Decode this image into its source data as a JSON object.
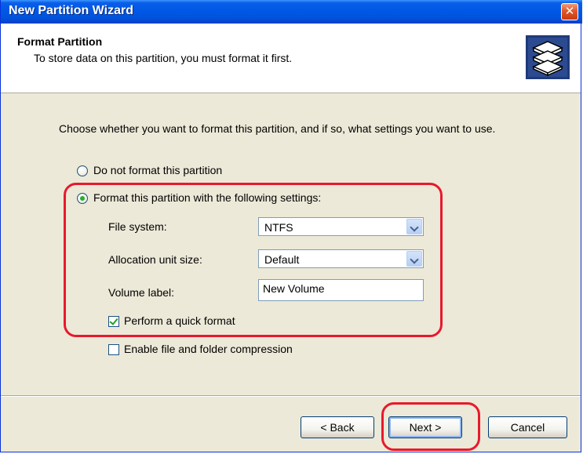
{
  "window": {
    "title": "New Partition Wizard",
    "close_symbol": "✕"
  },
  "header": {
    "title": "Format Partition",
    "subtitle": "To store data on this partition, you must format it first.",
    "icon": "disk-stack-icon"
  },
  "content": {
    "intro": "Choose whether you want to format this partition, and if so, what settings you want to use.",
    "option_no_format": {
      "label": "Do not format this partition",
      "selected": false
    },
    "option_format": {
      "label": "Format this partition with the following settings:",
      "selected": true
    },
    "file_system": {
      "label": "File system:",
      "value": "NTFS"
    },
    "allocation_unit": {
      "label": "Allocation unit size:",
      "value": "Default"
    },
    "volume_label": {
      "label": "Volume label:",
      "value": "New Volume"
    },
    "quick_format": {
      "label": "Perform a quick format",
      "checked": true
    },
    "compression": {
      "label": "Enable file and folder compression",
      "checked": false
    }
  },
  "buttons": {
    "back": "< Back",
    "next": "Next >",
    "cancel": "Cancel"
  },
  "colors": {
    "highlight": "#e8192c",
    "titlebar": "#0058e6",
    "dialog_bg": "#ece9d8"
  }
}
